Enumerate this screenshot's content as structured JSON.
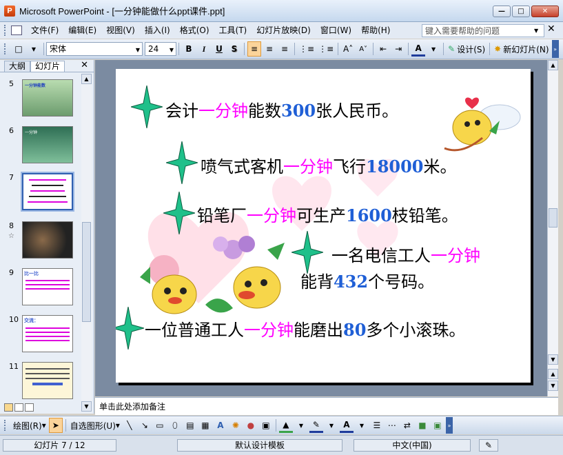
{
  "window": {
    "title": "Microsoft PowerPoint - [一分钟能做什么ppt课件.ppt]",
    "app_icon": "P"
  },
  "menu": {
    "items": [
      "文件(F)",
      "编辑(E)",
      "视图(V)",
      "插入(I)",
      "格式(O)",
      "工具(T)",
      "幻灯片放映(D)",
      "窗口(W)",
      "帮助(H)"
    ],
    "help_placeholder": "键入需要帮助的问题"
  },
  "toolbar": {
    "font": "宋体",
    "size": "24",
    "bold": "B",
    "italic": "I",
    "underline": "U",
    "shadow": "S",
    "design_label": "设计(S)",
    "new_slide_label": "新幻灯片(N)"
  },
  "left_pane": {
    "tabs": [
      "大纲",
      "幻灯片"
    ],
    "active_tab": "幻灯片",
    "thumbnails": [
      {
        "num": "5",
        "caption": "一分钟能数"
      },
      {
        "num": "6",
        "caption": "一分钟"
      },
      {
        "num": "7",
        "caption": "",
        "selected": true
      },
      {
        "num": "8",
        "caption": ""
      },
      {
        "num": "9",
        "caption": "比一比"
      },
      {
        "num": "10",
        "caption": "交流："
      },
      {
        "num": "11",
        "caption": ""
      }
    ]
  },
  "slide": {
    "lines": [
      {
        "prefix": "会计",
        "highlight": "一分钟",
        "middle": "能数",
        "number": "300",
        "suffix": "张人民币。"
      },
      {
        "prefix": "喷气式客机",
        "highlight": "一分钟",
        "middle": "飞行",
        "number": "18000",
        "suffix": "米。"
      },
      {
        "prefix": "铅笔厂",
        "highlight": "一分钟",
        "middle": "可生产",
        "number": "1600",
        "suffix": "枝铅笔。"
      },
      {
        "prefix": "一名电信工人",
        "highlight": "一分钟",
        "middle": "",
        "number": "",
        "suffix": ""
      },
      {
        "prefix": "能背",
        "highlight": "",
        "middle": "",
        "number": "432",
        "suffix": "个号码。"
      },
      {
        "prefix": "一位普通工人",
        "highlight": "一分钟",
        "middle": "能磨出",
        "number": "80",
        "suffix": "多个小滚珠。"
      }
    ]
  },
  "notes": {
    "placeholder": "单击此处添加备注"
  },
  "drawbar": {
    "draw_label": "绘图(R)",
    "autoshape_label": "自选图形(U)"
  },
  "status": {
    "slide": "幻灯片 7 / 12",
    "template": "默认设计模板",
    "language": "中文(中国)"
  },
  "colors": {
    "highlight": "#ff00ff",
    "number": "#1f5fd6",
    "star": "#1fc08a"
  }
}
